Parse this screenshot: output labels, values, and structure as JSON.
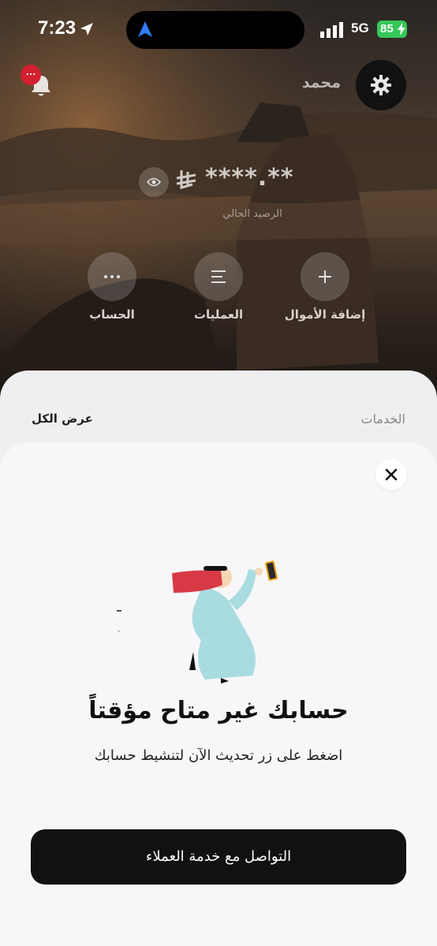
{
  "status_bar": {
    "time": "7:23",
    "network": "5G",
    "battery": "85"
  },
  "header": {
    "notification_badge": "...",
    "username": "محمد"
  },
  "balance": {
    "value": "****.**",
    "label": "الرصيد الحالي"
  },
  "actions": [
    {
      "label": "الحساب",
      "icon": "more-dots-icon"
    },
    {
      "label": "العمليات",
      "icon": "list-icon"
    },
    {
      "label": "إضافة الأموال",
      "icon": "plus-icon"
    }
  ],
  "services": {
    "title": "الخدمات",
    "view_all": "عرض الكل"
  },
  "modal": {
    "title": "حسابك غير متاح مؤقتاً",
    "subtitle": "اضغط على زر تحديث الآن لتنشيط حسابك",
    "button_label": "التواصل مع خدمة العملاء"
  },
  "colors": {
    "badge": "#d32030",
    "battery": "#35c759",
    "button": "#111111"
  }
}
